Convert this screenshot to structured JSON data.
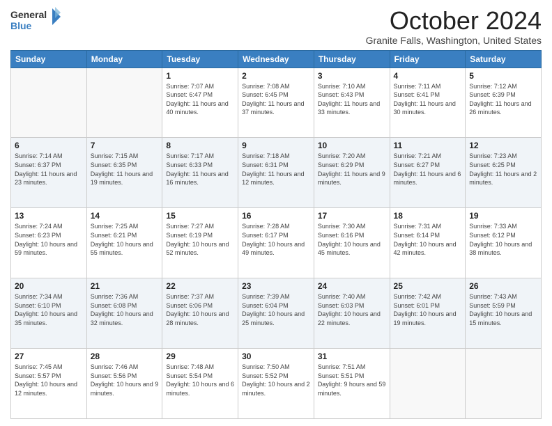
{
  "logo": {
    "line1": "General",
    "line2": "Blue"
  },
  "title": "October 2024",
  "location": "Granite Falls, Washington, United States",
  "weekdays": [
    "Sunday",
    "Monday",
    "Tuesday",
    "Wednesday",
    "Thursday",
    "Friday",
    "Saturday"
  ],
  "weeks": [
    [
      {
        "day": "",
        "info": ""
      },
      {
        "day": "",
        "info": ""
      },
      {
        "day": "1",
        "info": "Sunrise: 7:07 AM\nSunset: 6:47 PM\nDaylight: 11 hours and 40 minutes."
      },
      {
        "day": "2",
        "info": "Sunrise: 7:08 AM\nSunset: 6:45 PM\nDaylight: 11 hours and 37 minutes."
      },
      {
        "day": "3",
        "info": "Sunrise: 7:10 AM\nSunset: 6:43 PM\nDaylight: 11 hours and 33 minutes."
      },
      {
        "day": "4",
        "info": "Sunrise: 7:11 AM\nSunset: 6:41 PM\nDaylight: 11 hours and 30 minutes."
      },
      {
        "day": "5",
        "info": "Sunrise: 7:12 AM\nSunset: 6:39 PM\nDaylight: 11 hours and 26 minutes."
      }
    ],
    [
      {
        "day": "6",
        "info": "Sunrise: 7:14 AM\nSunset: 6:37 PM\nDaylight: 11 hours and 23 minutes."
      },
      {
        "day": "7",
        "info": "Sunrise: 7:15 AM\nSunset: 6:35 PM\nDaylight: 11 hours and 19 minutes."
      },
      {
        "day": "8",
        "info": "Sunrise: 7:17 AM\nSunset: 6:33 PM\nDaylight: 11 hours and 16 minutes."
      },
      {
        "day": "9",
        "info": "Sunrise: 7:18 AM\nSunset: 6:31 PM\nDaylight: 11 hours and 12 minutes."
      },
      {
        "day": "10",
        "info": "Sunrise: 7:20 AM\nSunset: 6:29 PM\nDaylight: 11 hours and 9 minutes."
      },
      {
        "day": "11",
        "info": "Sunrise: 7:21 AM\nSunset: 6:27 PM\nDaylight: 11 hours and 6 minutes."
      },
      {
        "day": "12",
        "info": "Sunrise: 7:23 AM\nSunset: 6:25 PM\nDaylight: 11 hours and 2 minutes."
      }
    ],
    [
      {
        "day": "13",
        "info": "Sunrise: 7:24 AM\nSunset: 6:23 PM\nDaylight: 10 hours and 59 minutes."
      },
      {
        "day": "14",
        "info": "Sunrise: 7:25 AM\nSunset: 6:21 PM\nDaylight: 10 hours and 55 minutes."
      },
      {
        "day": "15",
        "info": "Sunrise: 7:27 AM\nSunset: 6:19 PM\nDaylight: 10 hours and 52 minutes."
      },
      {
        "day": "16",
        "info": "Sunrise: 7:28 AM\nSunset: 6:17 PM\nDaylight: 10 hours and 49 minutes."
      },
      {
        "day": "17",
        "info": "Sunrise: 7:30 AM\nSunset: 6:16 PM\nDaylight: 10 hours and 45 minutes."
      },
      {
        "day": "18",
        "info": "Sunrise: 7:31 AM\nSunset: 6:14 PM\nDaylight: 10 hours and 42 minutes."
      },
      {
        "day": "19",
        "info": "Sunrise: 7:33 AM\nSunset: 6:12 PM\nDaylight: 10 hours and 38 minutes."
      }
    ],
    [
      {
        "day": "20",
        "info": "Sunrise: 7:34 AM\nSunset: 6:10 PM\nDaylight: 10 hours and 35 minutes."
      },
      {
        "day": "21",
        "info": "Sunrise: 7:36 AM\nSunset: 6:08 PM\nDaylight: 10 hours and 32 minutes."
      },
      {
        "day": "22",
        "info": "Sunrise: 7:37 AM\nSunset: 6:06 PM\nDaylight: 10 hours and 28 minutes."
      },
      {
        "day": "23",
        "info": "Sunrise: 7:39 AM\nSunset: 6:04 PM\nDaylight: 10 hours and 25 minutes."
      },
      {
        "day": "24",
        "info": "Sunrise: 7:40 AM\nSunset: 6:03 PM\nDaylight: 10 hours and 22 minutes."
      },
      {
        "day": "25",
        "info": "Sunrise: 7:42 AM\nSunset: 6:01 PM\nDaylight: 10 hours and 19 minutes."
      },
      {
        "day": "26",
        "info": "Sunrise: 7:43 AM\nSunset: 5:59 PM\nDaylight: 10 hours and 15 minutes."
      }
    ],
    [
      {
        "day": "27",
        "info": "Sunrise: 7:45 AM\nSunset: 5:57 PM\nDaylight: 10 hours and 12 minutes."
      },
      {
        "day": "28",
        "info": "Sunrise: 7:46 AM\nSunset: 5:56 PM\nDaylight: 10 hours and 9 minutes."
      },
      {
        "day": "29",
        "info": "Sunrise: 7:48 AM\nSunset: 5:54 PM\nDaylight: 10 hours and 6 minutes."
      },
      {
        "day": "30",
        "info": "Sunrise: 7:50 AM\nSunset: 5:52 PM\nDaylight: 10 hours and 2 minutes."
      },
      {
        "day": "31",
        "info": "Sunrise: 7:51 AM\nSunset: 5:51 PM\nDaylight: 9 hours and 59 minutes."
      },
      {
        "day": "",
        "info": ""
      },
      {
        "day": "",
        "info": ""
      }
    ]
  ]
}
